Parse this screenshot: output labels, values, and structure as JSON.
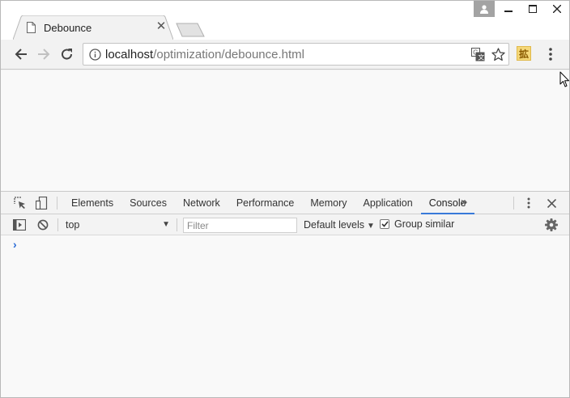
{
  "tab": {
    "title": "Debounce",
    "close_glyph": "✕"
  },
  "address_bar": {
    "host": "localhost",
    "path": "/optimization/debounce.html"
  },
  "extension": {
    "glyph": "拡"
  },
  "devtools": {
    "tabs": [
      {
        "label": "Elements"
      },
      {
        "label": "Sources"
      },
      {
        "label": "Network"
      },
      {
        "label": "Performance"
      },
      {
        "label": "Memory"
      },
      {
        "label": "Application"
      },
      {
        "label": "Console"
      }
    ],
    "active_tab": "Console",
    "more_glyph": "»",
    "close_glyph": "✕"
  },
  "console": {
    "context": "top",
    "context_arrow": "▼",
    "filter_placeholder": "Filter",
    "levels": "Default levels",
    "levels_arrow": "▼",
    "group_similar_label": "Group similar",
    "group_similar_checked": true,
    "prompt": "›"
  },
  "colors": {
    "accent": "#3879d9",
    "prompt": "#2a6bd6"
  },
  "icons": [
    "page-icon",
    "close-icon",
    "profile-icon",
    "minimize-icon",
    "maximize-icon",
    "back-icon",
    "forward-icon",
    "reload-icon",
    "info-icon",
    "translate-icon",
    "star-icon",
    "extension-icon",
    "menu-icon",
    "inspect-icon",
    "device-icon",
    "more-tabs-icon",
    "kebab-icon",
    "sidebar-icon",
    "clear-icon",
    "gear-icon",
    "cursor-icon"
  ]
}
